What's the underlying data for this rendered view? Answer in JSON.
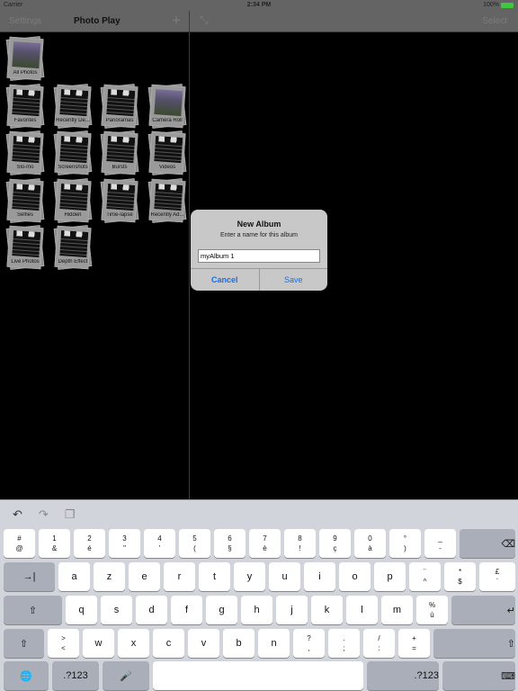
{
  "status": {
    "carrier": "Carrier",
    "time": "2:34 PM",
    "battery": "100%"
  },
  "nav": {
    "settings": "Settings",
    "title": "Photo Play",
    "add": "+",
    "expand": "⤡",
    "select": "Select"
  },
  "albums": [
    {
      "label": "All Photos",
      "type": "photo"
    },
    {
      "label": "Favorites",
      "type": "clap"
    },
    {
      "label": "Recently De...",
      "type": "clap"
    },
    {
      "label": "Panoramas",
      "type": "clap"
    },
    {
      "label": "Camera Roll",
      "type": "photo"
    },
    {
      "label": "Slo-mo",
      "type": "clap"
    },
    {
      "label": "Screenshots",
      "type": "clap"
    },
    {
      "label": "Bursts",
      "type": "clap"
    },
    {
      "label": "Videos",
      "type": "clap"
    },
    {
      "label": "Selfies",
      "type": "clap"
    },
    {
      "label": "Hidden",
      "type": "clap"
    },
    {
      "label": "Time-lapse",
      "type": "clap"
    },
    {
      "label": "Recently Ad...",
      "type": "clap"
    },
    {
      "label": "Live Photos",
      "type": "clap"
    },
    {
      "label": "Depth Effect",
      "type": "clap"
    }
  ],
  "alert": {
    "title": "New Album",
    "message": "Enter a name for this album",
    "value": "myAlbum 1",
    "cancel": "Cancel",
    "save": "Save"
  },
  "keyboard": {
    "tools": {
      "undo": "↶",
      "redo": "↷",
      "paste": "❐"
    },
    "row1": [
      [
        "#",
        "@"
      ],
      [
        "1",
        "&"
      ],
      [
        "2",
        "é"
      ],
      [
        "3",
        "\""
      ],
      [
        "4",
        "'"
      ],
      [
        "5",
        "("
      ],
      [
        "6",
        "§"
      ],
      [
        "7",
        "è"
      ],
      [
        "8",
        "!"
      ],
      [
        "9",
        "ç"
      ],
      [
        "0",
        "à"
      ],
      [
        "°",
        ")"
      ],
      [
        "_",
        "-"
      ]
    ],
    "delete": "⌫",
    "tab": "→|",
    "row2": [
      "a",
      "z",
      "e",
      "r",
      "t",
      "y",
      "u",
      "i",
      "o",
      "p"
    ],
    "row2_extra": [
      [
        "¨",
        "^"
      ],
      [
        "*",
        "$"
      ],
      [
        "£",
        "`"
      ]
    ],
    "shift": "⇧",
    "row3": [
      "q",
      "s",
      "d",
      "f",
      "g",
      "h",
      "j",
      "k",
      "l",
      "m"
    ],
    "row3_extra": [
      "%",
      "ù"
    ],
    "return": "↵",
    "row4_first": [
      ">",
      "<"
    ],
    "row4": [
      "w",
      "x",
      "c",
      "v",
      "b",
      "n"
    ],
    "row4_extra": [
      [
        "?",
        ","
      ],
      [
        ".",
        ";"
      ],
      [
        "/",
        ":"
      ],
      [
        "+",
        "="
      ]
    ],
    "globe": "🌐",
    "numbers": ".?123",
    "mic": "🎤",
    "hide": "⌨"
  },
  "colors": {
    "accent": "#1a6ee6",
    "battery": "#3fc83f"
  }
}
